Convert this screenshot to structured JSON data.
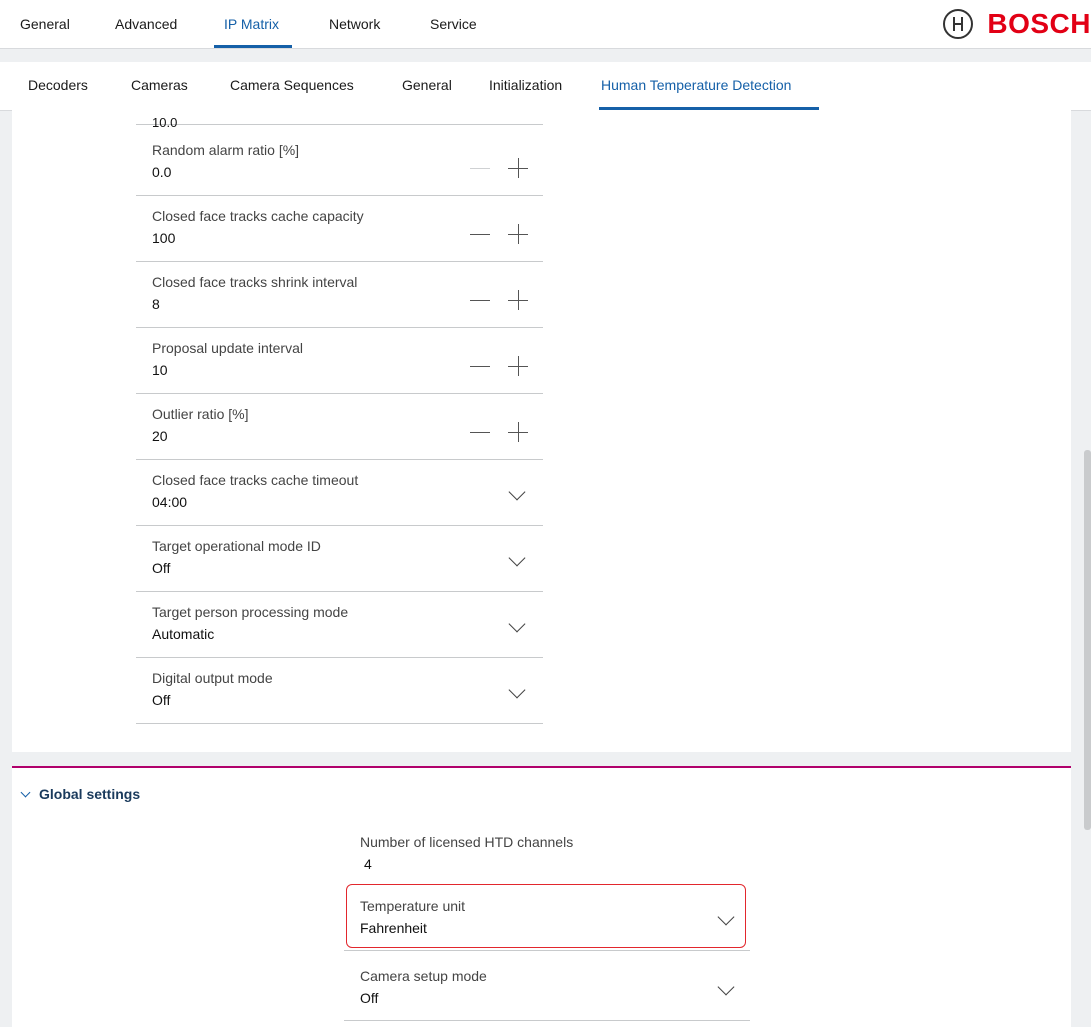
{
  "top_nav": {
    "tabs": [
      {
        "label": "General"
      },
      {
        "label": "Advanced"
      },
      {
        "label": "IP Matrix",
        "active": true
      },
      {
        "label": "Network"
      },
      {
        "label": "Service"
      }
    ],
    "brand": "BOSCH"
  },
  "sub_nav": {
    "tabs": [
      {
        "label": "Decoders"
      },
      {
        "label": "Cameras"
      },
      {
        "label": "Camera Sequences"
      },
      {
        "label": "General"
      },
      {
        "label": "Initialization"
      },
      {
        "label": "Human Temperature Detection",
        "active": true
      }
    ]
  },
  "settings": {
    "partial_value": "10.0",
    "rows": [
      {
        "label": "Random alarm ratio [%]",
        "value": "0.0",
        "control": "stepper",
        "minus_disabled": true
      },
      {
        "label": "Closed face tracks cache capacity",
        "value": "100",
        "control": "stepper"
      },
      {
        "label": "Closed face tracks shrink interval",
        "value": "8",
        "control": "stepper"
      },
      {
        "label": "Proposal update interval",
        "value": "10",
        "control": "stepper"
      },
      {
        "label": "Outlier ratio [%]",
        "value": "20",
        "control": "stepper"
      },
      {
        "label": "Closed face tracks cache timeout",
        "value": "04:00",
        "control": "dropdown"
      },
      {
        "label": "Target operational mode ID",
        "value": "Off",
        "control": "dropdown"
      },
      {
        "label": "Target person processing mode",
        "value": "Automatic",
        "control": "dropdown"
      },
      {
        "label": "Digital output mode",
        "value": "Off",
        "control": "dropdown"
      }
    ]
  },
  "global_settings": {
    "title": "Global settings",
    "rows": [
      {
        "label": "Number of licensed HTD channels",
        "value": "4"
      },
      {
        "label": "Temperature unit",
        "value": "Fahrenheit"
      },
      {
        "label": "Camera setup mode",
        "value": "Off"
      }
    ]
  },
  "colors": {
    "accent": "#1560a8",
    "brand": "#e20015",
    "section_divider": "#b0006b",
    "highlight": "#e2272d"
  }
}
